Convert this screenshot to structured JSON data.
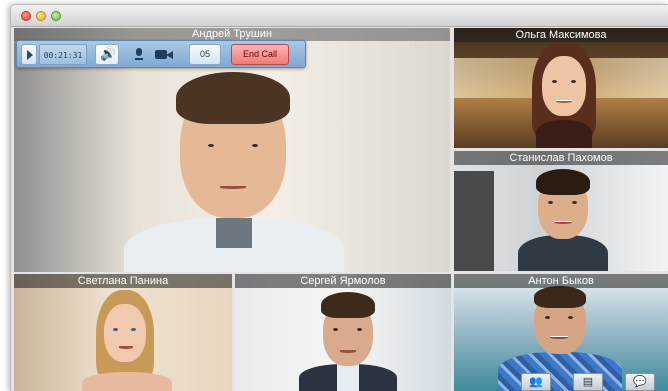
{
  "window": {
    "buttons": [
      "close",
      "minimize",
      "maximize"
    ]
  },
  "main": {
    "name": "Андрей Трушин"
  },
  "controls": {
    "timer": "00:21:31",
    "participant_count": "05",
    "end_call_label": "End Call",
    "icons": [
      "play-icon",
      "speaker-icon",
      "microphone-icon",
      "camera-icon"
    ]
  },
  "participants": [
    {
      "name": "Ольга Максимова"
    },
    {
      "name": "Станислав Пахомов"
    },
    {
      "name": "Светлана Панина"
    },
    {
      "name": "Сергей Ярмолов"
    },
    {
      "name": "Антон Быков"
    }
  ],
  "bottom_toolbar": {
    "icons": [
      "contacts-icon",
      "card-icon",
      "chat-icon"
    ]
  },
  "colors": {
    "control_bar": "#8fb5da",
    "end_call": "#ef7b7b",
    "label_bg": "#3a3a3a"
  }
}
